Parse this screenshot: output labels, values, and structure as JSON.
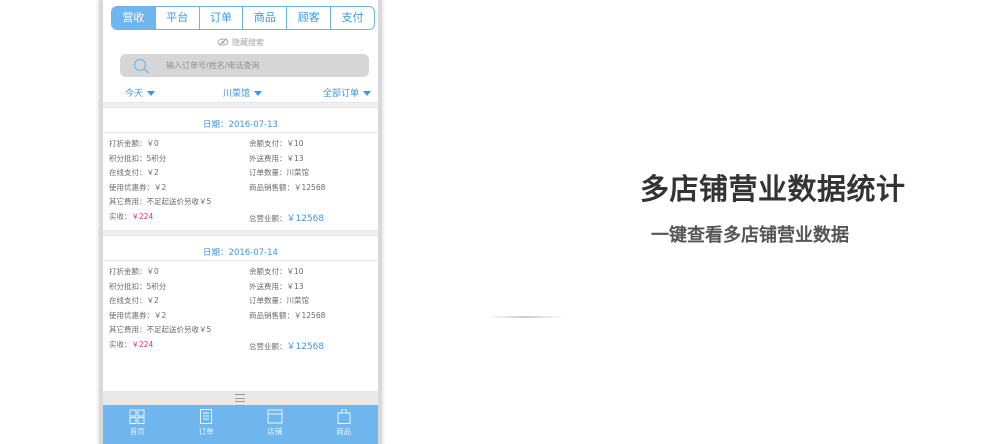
{
  "tabs": [
    "营收",
    "平台",
    "订单",
    "商品",
    "顾客",
    "支付"
  ],
  "hide_search": "隐藏搜索",
  "search": {
    "placeholder": "输入订单号/姓名/电话查询"
  },
  "filters": {
    "today": "今天",
    "store": "川菜馆",
    "orders": "全部订单"
  },
  "records": [
    {
      "date": "日期：2016-07-13",
      "rows": [
        [
          "打折金额：￥0",
          "余额支付：￥10"
        ],
        [
          "积分抵扣：5积分",
          "外送费用：￥13"
        ],
        [
          "在线支付：￥2",
          "订单数量：川菜馆"
        ],
        [
          "使用优惠券：￥2",
          "商品销售额：￥12568"
        ],
        [
          "其它费用：不足起送价另收￥5",
          ""
        ]
      ],
      "actual_label": "实收：",
      "actual_value": "￥224",
      "total_label": "总营业额：",
      "total_value": "￥12568"
    },
    {
      "date": "日期：2016-07-14",
      "rows": [
        [
          "打折金额：￥0",
          "余额支付：￥10"
        ],
        [
          "积分抵扣：5积分",
          "外送费用：￥13"
        ],
        [
          "在线支付：￥2",
          "订单数量：川菜馆"
        ],
        [
          "使用优惠券：￥2",
          "商品销售额：￥12568"
        ],
        [
          "其它费用：不足起送价另收￥5",
          ""
        ]
      ],
      "actual_label": "实收：",
      "actual_value": "￥224",
      "total_label": "总营业额：",
      "total_value": "￥12568"
    }
  ],
  "nav": [
    {
      "label": "首页",
      "icon": "grid-icon"
    },
    {
      "label": "订单",
      "icon": "document-icon"
    },
    {
      "label": "店铺",
      "icon": "store-icon"
    },
    {
      "label": "商品",
      "icon": "bag-icon"
    }
  ],
  "headline": "多店铺营业数据统计",
  "subline": "一键查看多店铺营业数据",
  "colors": {
    "accent": "#6fb6ee",
    "accent_text": "#3b97e3",
    "highlight": "#e4277f"
  }
}
